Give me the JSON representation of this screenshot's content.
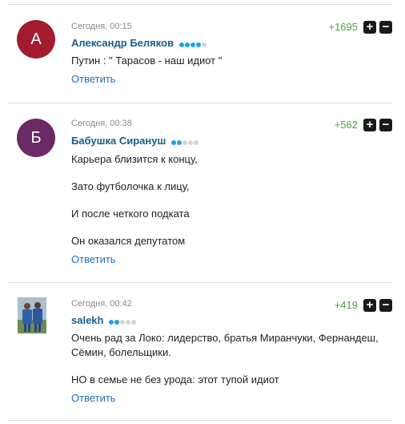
{
  "comments": [
    {
      "time": "Сегодня, 00:15",
      "author": "Александр Беляков",
      "avatar_letter": "А",
      "avatar_color": "#a41b2f",
      "level_dots": 4,
      "rating": "+1695",
      "lines": [
        "Путин : \" Тарасов - наш идиот \""
      ],
      "reply": "Ответить"
    },
    {
      "time": "Сегодня, 00:38",
      "author": "Бабушка Сирануш",
      "avatar_letter": "Б",
      "avatar_color": "#6a2a66",
      "level_dots": 2,
      "rating": "+562",
      "lines": [
        "Карьера близится к концу,",
        "Зато футболочка к лицу,",
        "И после четкого подката",
        "Он оказался депутатом"
      ],
      "reply": "Ответить"
    },
    {
      "time": "Сегодня, 00:42",
      "author": "salekh",
      "avatar_letter": "",
      "avatar_color": "#3a5f9c",
      "level_dots": 2,
      "rating": "+419",
      "lines": [
        "Очень рад за Локо: лидерство, братья Миранчуки, Фернандеш,",
        "Сёмин, болельщики.",
        "НО в семье не без урода: этот тупой идиот"
      ],
      "reply": "Ответить"
    }
  ],
  "controls": {
    "plus": "+",
    "minus": "−"
  }
}
